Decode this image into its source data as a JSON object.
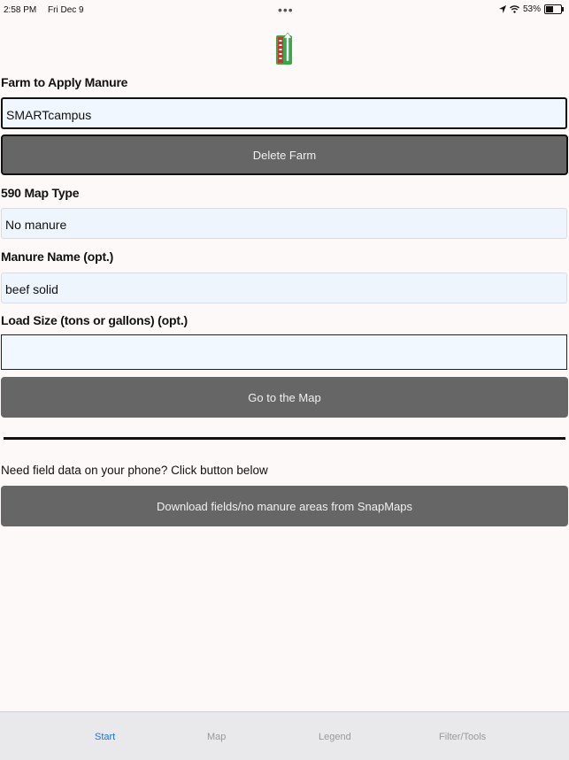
{
  "status": {
    "time": "2:58 PM",
    "date": "Fri Dec 9",
    "battery": "53%",
    "battery_level": 0.53
  },
  "form": {
    "farm_label": "Farm to Apply Manure",
    "farm_value": "SMARTcampus",
    "delete_farm_label": "Delete Farm",
    "map_type_label": "590 Map Type",
    "map_type_value": "No manure",
    "manure_name_label": "Manure Name (opt.)",
    "manure_name_value": "beef solid",
    "load_size_label": "Load Size (tons or gallons) (opt.)",
    "load_size_value": "",
    "go_to_map_label": "Go to the Map"
  },
  "download": {
    "prompt": "Need field data on your phone? Click button below",
    "button_label": "Download fields/no manure areas from SnapMaps"
  },
  "tabs": [
    {
      "label": "Start",
      "active": true
    },
    {
      "label": "Map",
      "active": false
    },
    {
      "label": "Legend",
      "active": false
    },
    {
      "label": "Filter/Tools",
      "active": false
    }
  ],
  "colors": {
    "button": "#666666",
    "active_tab": "#1a73d9",
    "inactive_tab": "#999999",
    "logo_green": "#3aa84a",
    "logo_red": "#c8342e"
  }
}
